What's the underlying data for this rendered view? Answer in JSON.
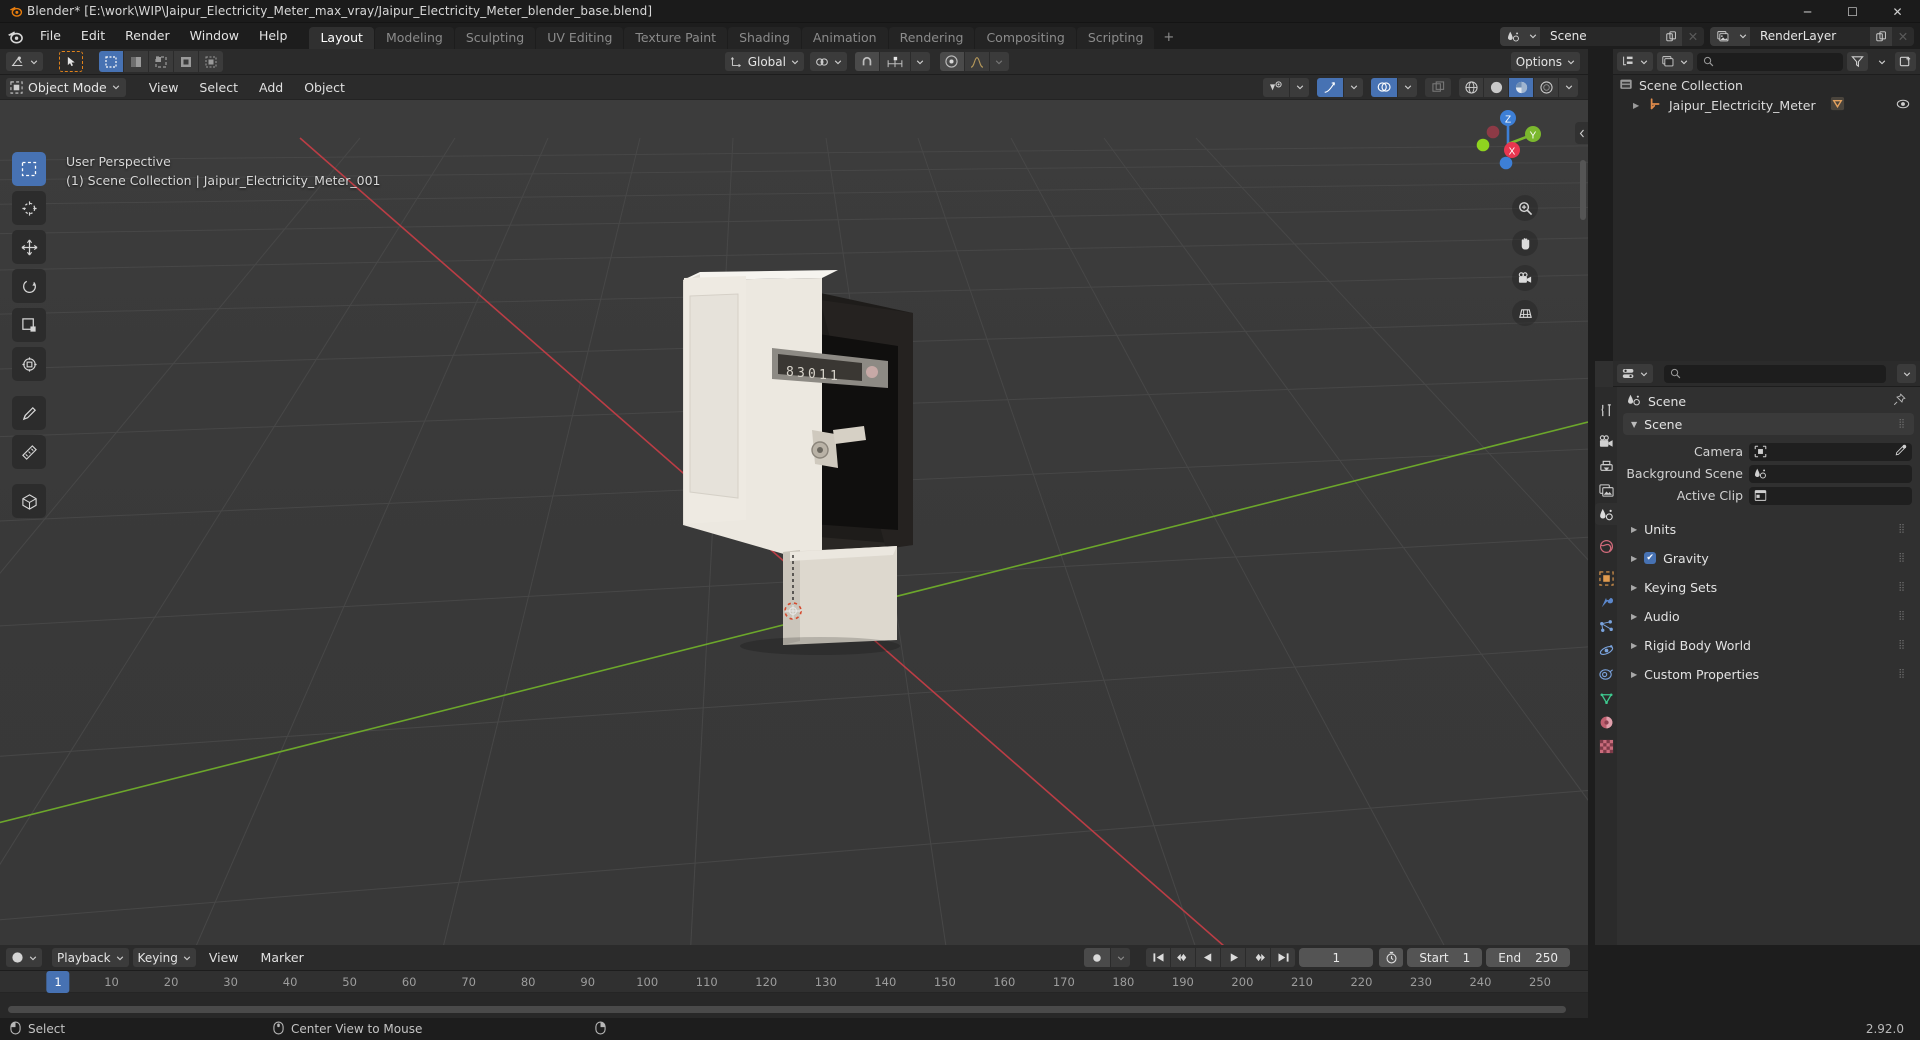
{
  "window": {
    "title": "Blender* [E:\\work\\WIP\\Jaipur_Electricity_Meter_max_vray/Jaipur_Electricity_Meter_blender_base.blend]",
    "minimize": "─",
    "maximize": "☐",
    "close": "✕"
  },
  "topbar": {
    "menus": [
      "File",
      "Edit",
      "Render",
      "Window",
      "Help"
    ],
    "workspaces": [
      {
        "label": "Layout",
        "active": true
      },
      {
        "label": "Modeling",
        "active": false
      },
      {
        "label": "Sculpting",
        "active": false
      },
      {
        "label": "UV Editing",
        "active": false
      },
      {
        "label": "Texture Paint",
        "active": false
      },
      {
        "label": "Shading",
        "active": false
      },
      {
        "label": "Animation",
        "active": false
      },
      {
        "label": "Rendering",
        "active": false
      },
      {
        "label": "Compositing",
        "active": false
      },
      {
        "label": "Scripting",
        "active": false
      }
    ],
    "add_workspace": "+",
    "scene_name": "Scene",
    "viewlayer_name": "RenderLayer"
  },
  "viewport": {
    "mode": "Object Mode",
    "menus": [
      "View",
      "Select",
      "Add",
      "Object"
    ],
    "transform_orientation": "Global",
    "options_label": "Options",
    "overlay_line1": "User Perspective",
    "overlay_line2": "(1) Scene Collection | Jaipur_Electricity_Meter_001",
    "gizmo_axes": [
      "X",
      "Y",
      "Z"
    ]
  },
  "outliner": {
    "search_placeholder": "",
    "rows": [
      {
        "label": "Scene Collection",
        "indent": 0,
        "expandable": false
      },
      {
        "label": "Jaipur_Electricity_Meter",
        "indent": 1,
        "expandable": true
      }
    ]
  },
  "properties": {
    "search_placeholder": "",
    "breadcrumb": "Scene",
    "panel_title": "Scene",
    "fields": [
      {
        "label": "Camera",
        "value": ""
      },
      {
        "label": "Background Scene",
        "value": ""
      },
      {
        "label": "Active Clip",
        "value": ""
      }
    ],
    "sections": [
      {
        "label": "Units",
        "checkbox": false
      },
      {
        "label": "Gravity",
        "checkbox": true
      },
      {
        "label": "Keying Sets",
        "checkbox": false
      },
      {
        "label": "Audio",
        "checkbox": false
      },
      {
        "label": "Rigid Body World",
        "checkbox": false
      },
      {
        "label": "Custom Properties",
        "checkbox": false
      }
    ]
  },
  "timeline": {
    "menus": [
      "Playback",
      "Keying",
      "View",
      "Marker"
    ],
    "ticks": [
      10,
      20,
      30,
      40,
      50,
      60,
      70,
      80,
      90,
      100,
      110,
      120,
      130,
      140,
      150,
      160,
      170,
      180,
      190,
      200,
      210,
      220,
      230,
      240,
      250
    ],
    "current_frame": "1",
    "current_frame_field": "1",
    "start_label": "Start",
    "start_value": "1",
    "end_label": "End",
    "end_value": "250"
  },
  "statusbar": {
    "items": [
      {
        "icon": "mouse-left-icon",
        "label": "Select"
      },
      {
        "icon": "mouse-middle-icon",
        "label": "Center View to Mouse"
      },
      {
        "icon": "mouse-right-icon",
        "label": ""
      }
    ],
    "version": "2.92.0"
  },
  "colors": {
    "accent": "#4772b3",
    "header": "#2b2b2b",
    "editor": "#303030",
    "viewport": "#3b3b3b",
    "axis_x": "#c7393f",
    "axis_y": "#7bb82e"
  }
}
